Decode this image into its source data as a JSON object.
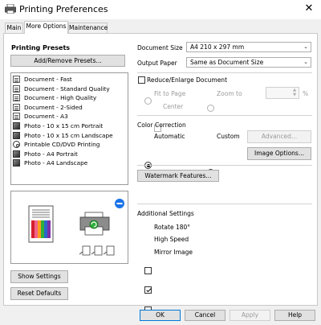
{
  "window": {
    "title": "Printing Preferences",
    "close_glyph": "✕"
  },
  "tabs": [
    {
      "label": "Main"
    },
    {
      "label": "More Options"
    },
    {
      "label": "Maintenance"
    }
  ],
  "presets": {
    "heading": "Printing Presets",
    "add_remove_label": "Add/Remove Presets...",
    "items": [
      {
        "label": "Document - Fast",
        "icon": "document-icon"
      },
      {
        "label": "Document - Standard Quality",
        "icon": "document-icon"
      },
      {
        "label": "Document - High Quality",
        "icon": "document-icon"
      },
      {
        "label": "Document - 2-Sided",
        "icon": "document-icon"
      },
      {
        "label": "Document - A3",
        "icon": "document-icon"
      },
      {
        "label": "Photo - 10 x 15 cm Portrait",
        "icon": "photo-icon"
      },
      {
        "label": "Photo - 10 x 15 cm Landscape",
        "icon": "photo-icon"
      },
      {
        "label": "Printable CD/DVD Printing",
        "icon": "disc-icon"
      },
      {
        "label": "Photo - A4 Portrait",
        "icon": "photo-icon"
      },
      {
        "label": "Photo - A4 Landscape",
        "icon": "photo-icon"
      }
    ]
  },
  "left_buttons": {
    "show_settings": "Show Settings",
    "reset_defaults": "Reset Defaults"
  },
  "paper": {
    "document_size_label": "Document Size",
    "document_size_value": "A4 210 x 297 mm",
    "output_paper_label": "Output Paper",
    "output_paper_value": "Same as Document Size"
  },
  "reduce": {
    "label": "Reduce/Enlarge Document",
    "fit_to_page": "Fit to Page",
    "zoom_to": "Zoom to",
    "percent": "%",
    "center": "Center"
  },
  "color_correction": {
    "heading": "Color Correction",
    "automatic": "Automatic",
    "custom": "Custom",
    "advanced": "Advanced...",
    "image_options": "Image Options..."
  },
  "watermark": {
    "label": "Watermark Features..."
  },
  "additional": {
    "heading": "Additional Settings",
    "rotate": "Rotate 180°",
    "high_speed": "High Speed",
    "mirror": "Mirror Image",
    "rotate_checked": false,
    "high_speed_checked": true,
    "mirror_checked": false
  },
  "dialog_buttons": {
    "ok": "OK",
    "cancel": "Cancel",
    "apply": "Apply",
    "help": "Help"
  },
  "colors": {
    "accent": "#0078d7",
    "window_bg": "#f0f0f0",
    "panel_bg": "#ffffff"
  }
}
